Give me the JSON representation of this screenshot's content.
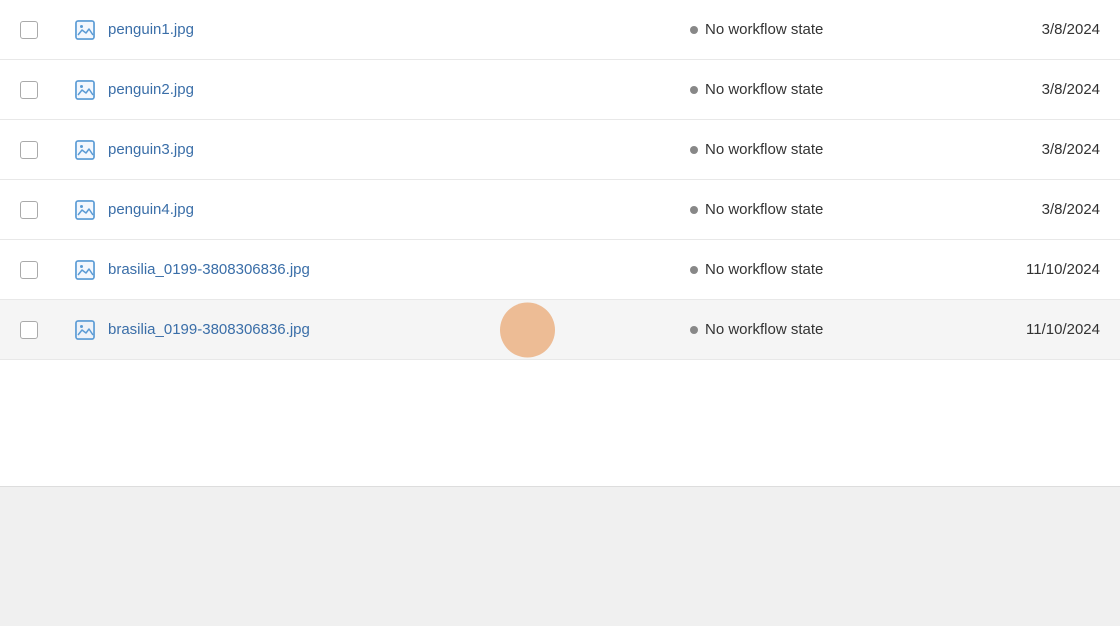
{
  "rows": [
    {
      "id": "row-1",
      "filename": "penguin1.jpg",
      "workflow": "No workflow state",
      "date": "3/8/2024",
      "highlighted": false,
      "showCursor": false
    },
    {
      "id": "row-2",
      "filename": "penguin2.jpg",
      "workflow": "No workflow state",
      "date": "3/8/2024",
      "highlighted": false,
      "showCursor": false
    },
    {
      "id": "row-3",
      "filename": "penguin3.jpg",
      "workflow": "No workflow state",
      "date": "3/8/2024",
      "highlighted": false,
      "showCursor": false
    },
    {
      "id": "row-4",
      "filename": "penguin4.jpg",
      "workflow": "No workflow state",
      "date": "3/8/2024",
      "highlighted": false,
      "showCursor": false
    },
    {
      "id": "row-5",
      "filename": "brasilia_0199-3808306836.jpg",
      "workflow": "No workflow state",
      "date": "11/10/2024",
      "highlighted": false,
      "showCursor": false
    },
    {
      "id": "row-6",
      "filename": "brasilia_0199-3808306836.jpg",
      "workflow": "No workflow state",
      "date": "11/10/2024",
      "highlighted": true,
      "showCursor": true
    }
  ],
  "colors": {
    "accent": "#e8934a",
    "link": "#3a6ea8",
    "dot": "#888888",
    "border": "#e8e8e8",
    "highlight_bg": "#f5f5f5",
    "bottom_bg": "#f0f0f0"
  }
}
